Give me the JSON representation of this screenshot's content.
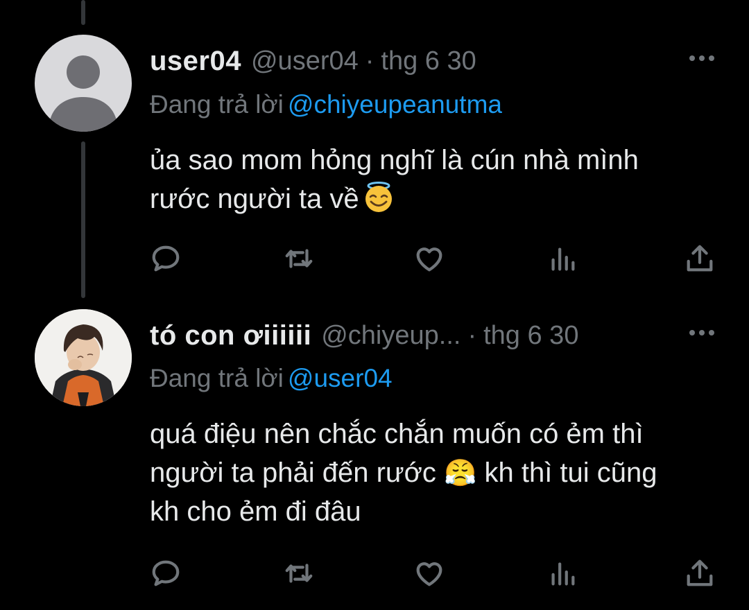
{
  "tweets": [
    {
      "name": "user04",
      "handle": "@user04",
      "dot": "·",
      "time": "thg 6 30",
      "reply_prefix": "Đang trả lời",
      "reply_mention": "@chiyeupeanutma",
      "text_line1": "ủa sao mom hỏng nghĩ là cún nhà mình",
      "text_line2": "rước người ta về",
      "emoji": "smiling-face-with-halo"
    },
    {
      "name": "tó con ơiiiiii",
      "handle": "@chiyeup...",
      "dot": "·",
      "time": "thg 6 30",
      "reply_prefix": "Đang trả lời",
      "reply_mention": "@user04",
      "text_line1": "quá điệu nên chắc chắn muốn có ẻm thì",
      "text_line2a": "người ta phải đến rước",
      "emoji_glyph": "😤",
      "text_line2b": "kh thì tui cũng",
      "text_line3": "kh cho ẻm đi đâu"
    }
  ],
  "colors": {
    "background": "#000000",
    "text": "#e7e9ea",
    "muted": "#71767b",
    "link": "#1d9bf0",
    "thread_line": "#333639"
  },
  "icons": [
    "reply-icon",
    "retweet-icon",
    "like-icon",
    "views-icon",
    "share-icon",
    "more-icon"
  ]
}
